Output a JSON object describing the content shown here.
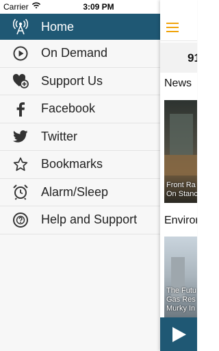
{
  "status_bar": {
    "carrier": "Carrier",
    "time": "3:09 PM"
  },
  "menu": {
    "items": [
      {
        "label": "Home",
        "icon": "antenna-icon"
      },
      {
        "label": "On Demand",
        "icon": "play-circle-icon"
      },
      {
        "label": "Support Us",
        "icon": "heart-plus-icon"
      },
      {
        "label": "Facebook",
        "icon": "facebook-icon"
      },
      {
        "label": "Twitter",
        "icon": "twitter-icon"
      },
      {
        "label": "Bookmarks",
        "icon": "star-icon"
      },
      {
        "label": "Alarm/Sleep",
        "icon": "alarm-clock-icon"
      },
      {
        "label": "Help and Support",
        "icon": "help-icon"
      }
    ],
    "active_color": "#1f5874"
  },
  "main": {
    "station_text": "91",
    "sections": [
      {
        "title": "News",
        "card_caption_line1": "Front Ra",
        "card_caption_line2": "On Stanc"
      },
      {
        "title": "Environ",
        "card_caption_line1": "The Futu",
        "card_caption_line2": "Gas Res",
        "card_caption_line3": "Murky In"
      }
    ],
    "accent_color": "#f0a30a"
  }
}
